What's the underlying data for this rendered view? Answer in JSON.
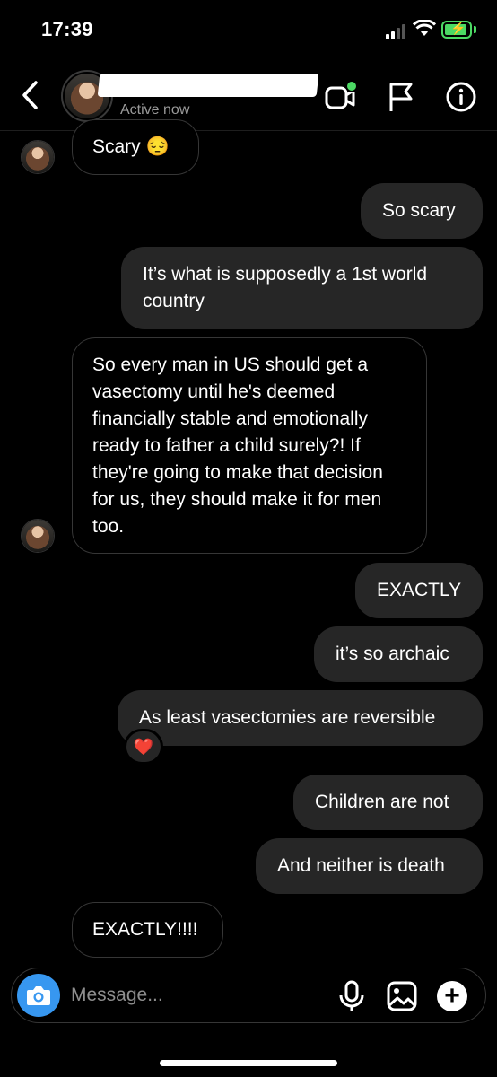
{
  "status_bar": {
    "time": "17:39",
    "battery_color": "#4cd964"
  },
  "header": {
    "subtitle": "Active now",
    "icons": [
      "chevron-left-icon",
      "video-call-icon",
      "flag-icon",
      "info-icon"
    ],
    "online_dot_color": "#4cd964"
  },
  "messages": [
    {
      "sender": "them",
      "text": "Scary 😔"
    },
    {
      "sender": "me",
      "text": "So scary"
    },
    {
      "sender": "me",
      "text": "It’s what is supposedly a 1st world country"
    },
    {
      "sender": "them",
      "text": "So every man in US should get a vasectomy until he's deemed financially stable and emotionally ready to father a child surely?! If they're going to make that decision for us, they should make it for men too."
    },
    {
      "sender": "me",
      "text": "EXACTLY"
    },
    {
      "sender": "me",
      "text": "it’s so archaic"
    },
    {
      "sender": "me",
      "text": "As least vasectomies are reversible",
      "reaction": "❤️"
    },
    {
      "sender": "me",
      "text": "Children are not"
    },
    {
      "sender": "me",
      "text": "And neither is death"
    },
    {
      "sender": "them",
      "text": "EXACTLY!!!!"
    }
  ],
  "composer": {
    "placeholder": "Message...",
    "accent_color": "#3797f0",
    "icons": [
      "camera-icon",
      "microphone-icon",
      "gallery-icon",
      "plus-icon"
    ]
  },
  "colors": {
    "background": "#000000",
    "outgoing_bubble": "#262626",
    "incoming_border": "#363636"
  }
}
